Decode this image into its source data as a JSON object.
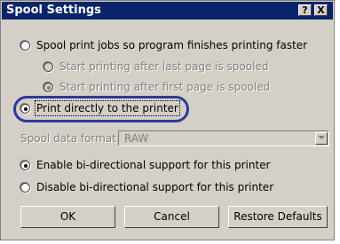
{
  "window": {
    "title": "Spool Settings",
    "help_glyph": "?",
    "close_glyph": "X"
  },
  "options": {
    "spool": "Spool print jobs so program finishes printing faster",
    "start_last": "Start printing after last page is spooled",
    "start_first": "Start printing after first page is spooled",
    "direct": "Print directly to the printer",
    "spool_format_label": "Spool data format:",
    "spool_format_value": "RAW",
    "bidi_enable": "Enable bi-directional support for this printer",
    "bidi_disable": "Disable bi-directional support for this printer"
  },
  "buttons": {
    "ok": "OK",
    "cancel": "Cancel",
    "restore": "Restore Defaults"
  },
  "state": {
    "selected_spool_mode": "direct",
    "selected_bidi": "enable"
  },
  "colors": {
    "titlebar": "#0a246a",
    "dialog": "#d4d0c8",
    "highlight": "#2b3a99"
  }
}
